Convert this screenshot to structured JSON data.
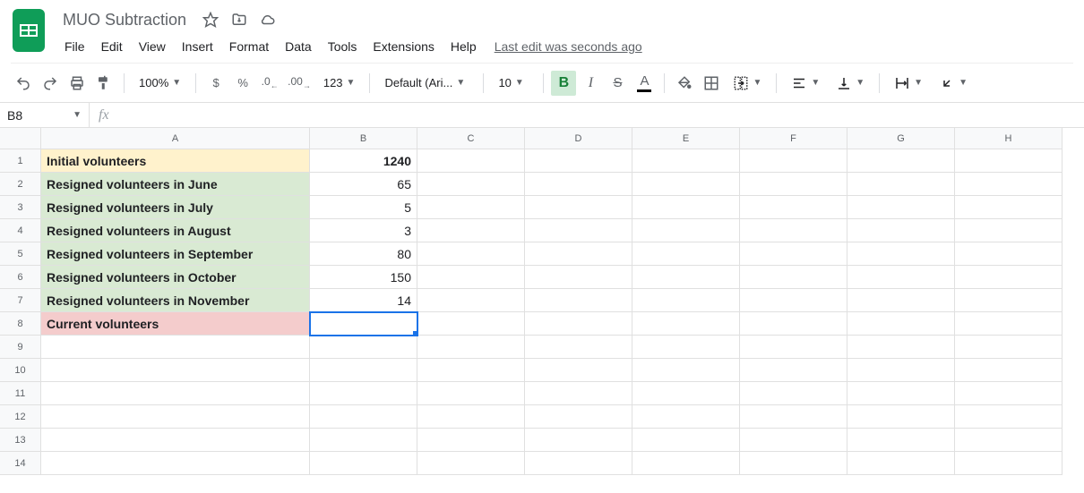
{
  "doc": {
    "title": "MUO Subtraction",
    "last_edit": "Last edit was seconds ago"
  },
  "menus": {
    "file": "File",
    "edit": "Edit",
    "view": "View",
    "insert": "Insert",
    "format": "Format",
    "data": "Data",
    "tools": "Tools",
    "extensions": "Extensions",
    "help": "Help"
  },
  "toolbar": {
    "zoom": "100%",
    "currency": "$",
    "percent": "%",
    "dec_dec": ".0",
    "dec_inc": ".00",
    "num123": "123",
    "font": "Default (Ari...",
    "size": "10"
  },
  "namebox": "B8",
  "formula": "",
  "columns": [
    "A",
    "B",
    "C",
    "D",
    "E",
    "F",
    "G",
    "H"
  ],
  "rows": [
    "1",
    "2",
    "3",
    "4",
    "5",
    "6",
    "7",
    "8",
    "9",
    "10",
    "11",
    "12",
    "13",
    "14"
  ],
  "sheet": {
    "r1": {
      "a": "Initial volunteers",
      "b": "1240"
    },
    "r2": {
      "a": "Resigned volunteers in June",
      "b": "65"
    },
    "r3": {
      "a": "Resigned volunteers in July",
      "b": "5"
    },
    "r4": {
      "a": "Resigned volunteers in August",
      "b": "3"
    },
    "r5": {
      "a": "Resigned volunteers in September",
      "b": "80"
    },
    "r6": {
      "a": "Resigned volunteers in October",
      "b": "150"
    },
    "r7": {
      "a": "Resigned volunteers in November",
      "b": "14"
    },
    "r8": {
      "a": "Current volunteers",
      "b": ""
    }
  }
}
